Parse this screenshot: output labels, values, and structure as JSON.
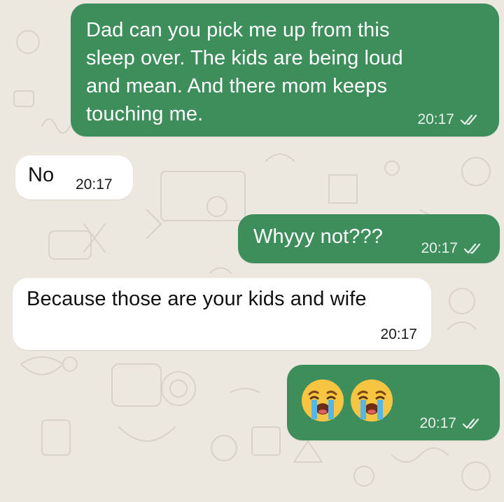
{
  "chat": {
    "messages": [
      {
        "id": "m1",
        "direction": "outgoing",
        "text": "Dad can you pick me up from this\nsleep over. The kids are being loud\nand mean. And there mom keeps\ntouching me.",
        "time": "20:17",
        "status": "read-double-check"
      },
      {
        "id": "m2",
        "direction": "incoming",
        "text": "No",
        "time": "20:17"
      },
      {
        "id": "m3",
        "direction": "outgoing",
        "text": "Whyyy not???",
        "time": "20:17",
        "status": "read-double-check"
      },
      {
        "id": "m4",
        "direction": "incoming",
        "text": "Because those are your kids and wife",
        "time": "20:17"
      },
      {
        "id": "m5",
        "direction": "outgoing",
        "emoji": [
          "loudly-crying-face",
          "loudly-crying-face"
        ],
        "time": "20:17",
        "status": "read-double-check"
      }
    ]
  },
  "theme": {
    "outgoing_bubble": "#3e8e5c",
    "incoming_bubble": "#ffffff",
    "background": "#ece7df"
  }
}
